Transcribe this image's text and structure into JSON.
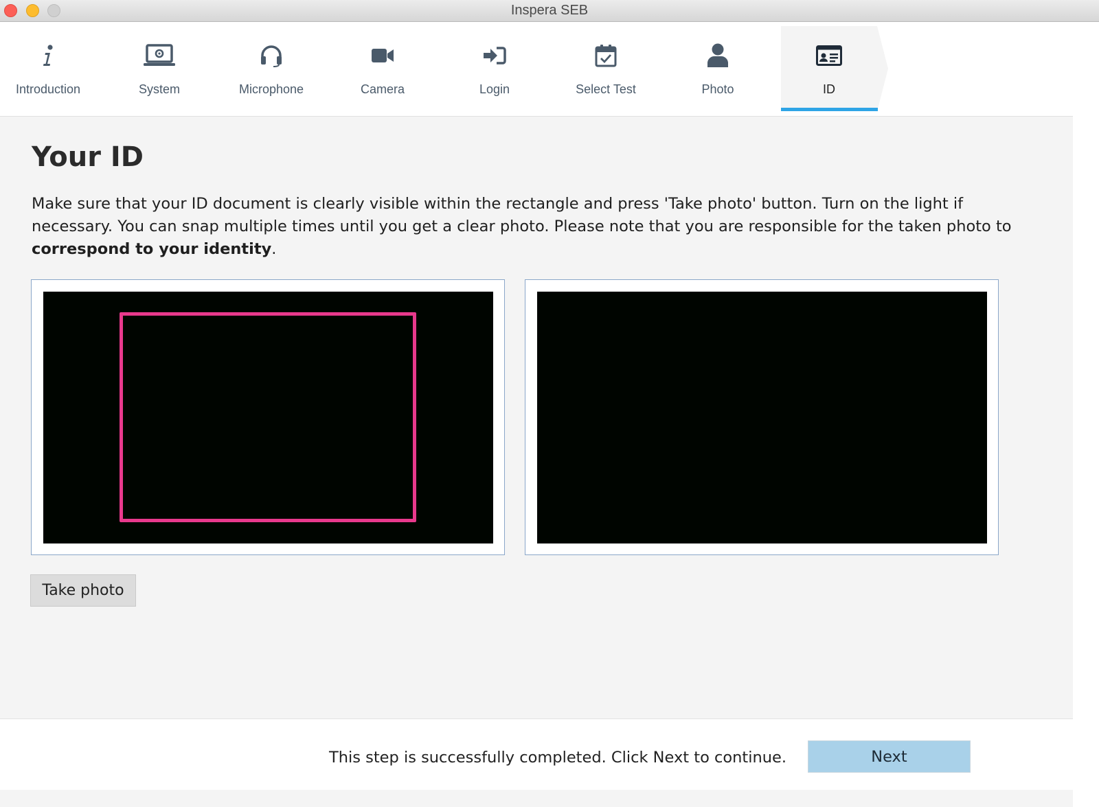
{
  "window": {
    "title": "Inspera SEB"
  },
  "nav": {
    "steps": [
      {
        "label": "Introduction",
        "icon": "info-icon"
      },
      {
        "label": "System",
        "icon": "laptop-icon"
      },
      {
        "label": "Microphone",
        "icon": "headset-icon"
      },
      {
        "label": "Camera",
        "icon": "video-camera-icon"
      },
      {
        "label": "Login",
        "icon": "sign-in-icon"
      },
      {
        "label": "Select Test",
        "icon": "calendar-check-icon"
      },
      {
        "label": "Photo",
        "icon": "user-icon"
      },
      {
        "label": "ID",
        "icon": "id-card-icon"
      }
    ],
    "active_step": "ID"
  },
  "page": {
    "title": "Your ID",
    "description_part1": "Make sure that your ID document is clearly visible within the rectangle and press 'Take photo' button. Turn on the light if necessary. You can snap multiple times until you get a clear photo. Please note that you are responsible for the taken photo to ",
    "description_bold": "correspond to your identity",
    "description_end": "."
  },
  "actions": {
    "take_photo_label": "Take photo"
  },
  "footer": {
    "status_message": "This step is successfully completed. Click Next to continue.",
    "next_label": "Next"
  },
  "colors": {
    "accent": "#2ea4e6",
    "guide_rectangle": "#e8398c",
    "next_button": "#a9d1e9",
    "icon": "#4a5a6a"
  }
}
